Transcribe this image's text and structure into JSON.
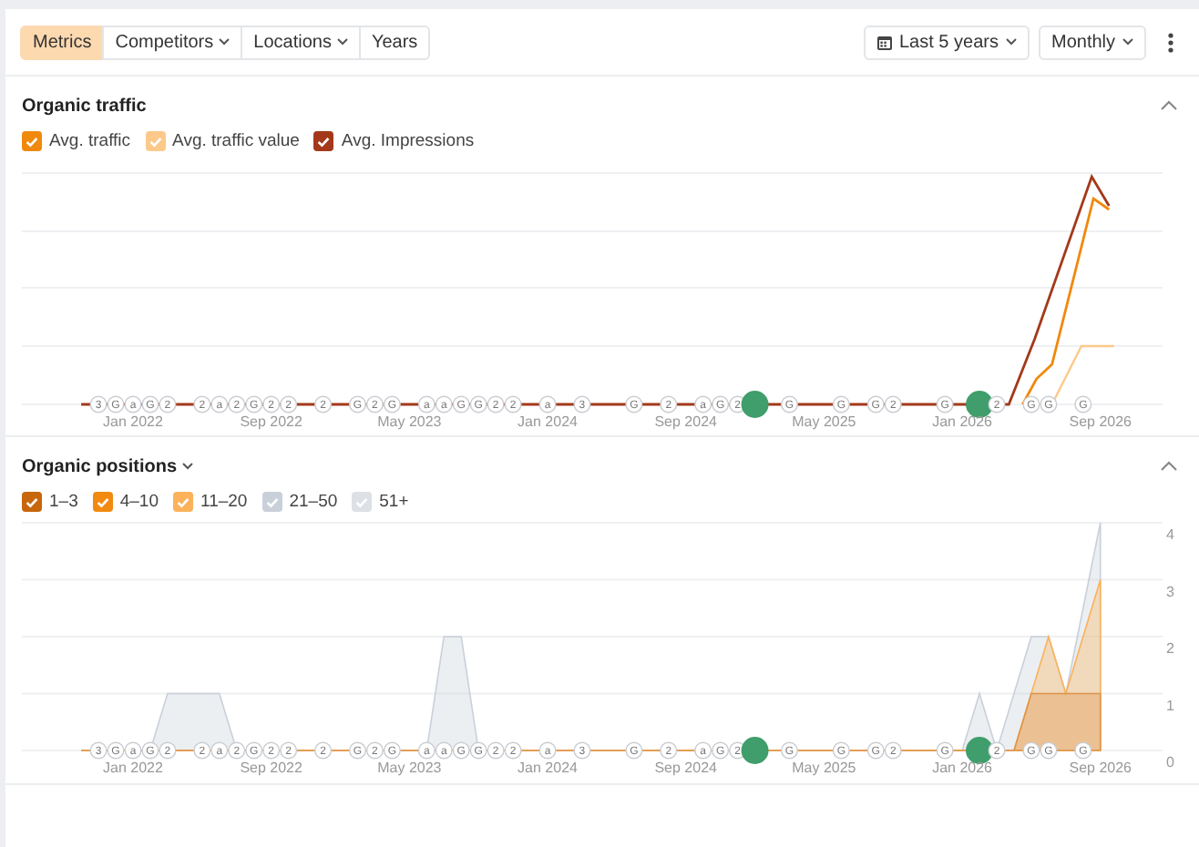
{
  "toolbar": {
    "tabs": [
      {
        "label": "Metrics",
        "selected": true,
        "dropdown": false
      },
      {
        "label": "Competitors",
        "selected": false,
        "dropdown": true
      },
      {
        "label": "Locations",
        "selected": false,
        "dropdown": true
      },
      {
        "label": "Years",
        "selected": false,
        "dropdown": false
      }
    ],
    "date_range": {
      "label": "Last 5 years"
    },
    "interval": {
      "label": "Monthly"
    }
  },
  "sections": [
    {
      "kind": "traffic",
      "title": "Organic traffic",
      "title_dropdown": false,
      "expanded": true,
      "legend": [
        {
          "label": "Avg. traffic",
          "checked": true,
          "color": "#f0890c"
        },
        {
          "label": "Avg. traffic value",
          "checked": true,
          "color": "#fcc98a"
        },
        {
          "label": "Avg. Impressions",
          "checked": true,
          "color": "#a3391a"
        }
      ],
      "timeline": [
        {
          "kind": "none"
        },
        {
          "kind": "tag",
          "label": "3"
        },
        {
          "kind": "tag",
          "label": "G"
        },
        {
          "kind": "tag",
          "label": "a",
          "axis_label": "Jan 2022"
        },
        {
          "kind": "tag",
          "label": "G"
        },
        {
          "kind": "tag",
          "label": "2"
        },
        {
          "kind": "none"
        },
        {
          "kind": "tag",
          "label": "2"
        },
        {
          "kind": "tag",
          "label": "a"
        },
        {
          "kind": "tag",
          "label": "2"
        },
        {
          "kind": "tag",
          "label": "G"
        },
        {
          "kind": "tag",
          "label": "2",
          "axis_label": "Sep 2022"
        },
        {
          "kind": "tag",
          "label": "2"
        },
        {
          "kind": "none"
        },
        {
          "kind": "tag",
          "label": "2"
        },
        {
          "kind": "none"
        },
        {
          "kind": "tag",
          "label": "G"
        },
        {
          "kind": "tag",
          "label": "2"
        },
        {
          "kind": "tag",
          "label": "G"
        },
        {
          "kind": "none",
          "axis_label": "May 2023"
        },
        {
          "kind": "tag",
          "label": "a"
        },
        {
          "kind": "tag",
          "label": "a"
        },
        {
          "kind": "tag",
          "label": "G"
        },
        {
          "kind": "tag",
          "label": "G"
        },
        {
          "kind": "tag",
          "label": "2"
        },
        {
          "kind": "tag",
          "label": "2"
        },
        {
          "kind": "none"
        },
        {
          "kind": "tag",
          "label": "a",
          "axis_label": "Jan 2024"
        },
        {
          "kind": "none"
        },
        {
          "kind": "tag",
          "label": "3"
        },
        {
          "kind": "none"
        },
        {
          "kind": "none"
        },
        {
          "kind": "tag",
          "label": "G"
        },
        {
          "kind": "none"
        },
        {
          "kind": "tag",
          "label": "2"
        },
        {
          "kind": "none",
          "axis_label": "Sep 2024"
        },
        {
          "kind": "tag",
          "label": "a"
        },
        {
          "kind": "tag",
          "label": "G"
        },
        {
          "kind": "tag",
          "label": "2"
        },
        {
          "kind": "event"
        },
        {
          "kind": "none"
        },
        {
          "kind": "tag",
          "label": "G"
        },
        {
          "kind": "none"
        },
        {
          "kind": "none",
          "axis_label": "May 2025"
        },
        {
          "kind": "tag",
          "label": "G"
        },
        {
          "kind": "none"
        },
        {
          "kind": "tag",
          "label": "G"
        },
        {
          "kind": "tag",
          "label": "2"
        },
        {
          "kind": "none"
        },
        {
          "kind": "none"
        },
        {
          "kind": "tag",
          "label": "G"
        },
        {
          "kind": "none",
          "axis_label": "Jan 2026"
        },
        {
          "kind": "event"
        },
        {
          "kind": "tag",
          "label": "2"
        },
        {
          "kind": "none"
        },
        {
          "kind": "tag",
          "label": "G"
        },
        {
          "kind": "tag",
          "label": "G"
        },
        {
          "kind": "none"
        },
        {
          "kind": "tag",
          "label": "G"
        },
        {
          "kind": "none",
          "axis_label": "Sep 2026"
        }
      ]
    },
    {
      "kind": "positions",
      "title": "Organic positions",
      "title_dropdown": true,
      "expanded": true,
      "legend": [
        {
          "label": "1–3",
          "checked": true,
          "color": "#c8660c"
        },
        {
          "label": "4–10",
          "checked": true,
          "color": "#f28a10"
        },
        {
          "label": "11–20",
          "checked": true,
          "color": "#fbb25a"
        },
        {
          "label": "21–50",
          "checked": true,
          "color": "#c9d0da"
        },
        {
          "label": "51+",
          "checked": true,
          "color": "#dde1e6"
        }
      ],
      "timeline": [
        {
          "kind": "none"
        },
        {
          "kind": "tag",
          "label": "3"
        },
        {
          "kind": "tag",
          "label": "G"
        },
        {
          "kind": "tag",
          "label": "a"
        },
        {
          "kind": "tag",
          "label": "G"
        },
        {
          "kind": "tag",
          "label": "2"
        },
        {
          "kind": "none"
        },
        {
          "kind": "tag",
          "label": "2"
        },
        {
          "kind": "tag",
          "label": "a"
        },
        {
          "kind": "tag",
          "label": "2"
        },
        {
          "kind": "tag",
          "label": "G"
        },
        {
          "kind": "tag",
          "label": "2"
        },
        {
          "kind": "tag",
          "label": "2"
        },
        {
          "kind": "none"
        },
        {
          "kind": "tag",
          "label": "2"
        },
        {
          "kind": "none"
        },
        {
          "kind": "tag",
          "label": "G"
        },
        {
          "kind": "tag",
          "label": "2"
        },
        {
          "kind": "tag",
          "label": "G"
        },
        {
          "kind": "none"
        },
        {
          "kind": "tag",
          "label": "a"
        },
        {
          "kind": "tag",
          "label": "a"
        },
        {
          "kind": "tag",
          "label": "G"
        },
        {
          "kind": "tag",
          "label": "G"
        },
        {
          "kind": "tag",
          "label": "2"
        },
        {
          "kind": "tag",
          "label": "2"
        },
        {
          "kind": "none"
        },
        {
          "kind": "tag",
          "label": "a"
        },
        {
          "kind": "none"
        },
        {
          "kind": "tag",
          "label": "3"
        },
        {
          "kind": "none"
        },
        {
          "kind": "none"
        },
        {
          "kind": "tag",
          "label": "G"
        },
        {
          "kind": "none"
        },
        {
          "kind": "tag",
          "label": "2"
        },
        {
          "kind": "none"
        },
        {
          "kind": "tag",
          "label": "a"
        },
        {
          "kind": "tag",
          "label": "G"
        },
        {
          "kind": "tag",
          "label": "2"
        },
        {
          "kind": "event"
        },
        {
          "kind": "none"
        },
        {
          "kind": "tag",
          "label": "G"
        },
        {
          "kind": "none"
        },
        {
          "kind": "none"
        },
        {
          "kind": "tag",
          "label": "G"
        },
        {
          "kind": "none"
        },
        {
          "kind": "tag",
          "label": "G"
        },
        {
          "kind": "tag",
          "label": "2"
        },
        {
          "kind": "none"
        },
        {
          "kind": "none"
        },
        {
          "kind": "tag",
          "label": "G"
        },
        {
          "kind": "none"
        },
        {
          "kind": "event"
        },
        {
          "kind": "tag",
          "label": "2"
        },
        {
          "kind": "none"
        },
        {
          "kind": "tag",
          "label": "G"
        },
        {
          "kind": "tag",
          "label": "G"
        },
        {
          "kind": "none"
        },
        {
          "kind": "tag",
          "label": "G"
        },
        {
          "kind": "none"
        }
      ],
      "chart_data": {
        "type": "area",
        "grid": true,
        "categories": [
          null,
          null,
          null,
          "Jan 2022",
          null,
          null,
          null,
          null,
          null,
          null,
          null,
          "Sep 2022",
          null,
          null,
          null,
          null,
          null,
          null,
          null,
          "May 2023",
          null,
          null,
          null,
          null,
          null,
          null,
          null,
          "Jan 2024",
          null,
          null,
          null,
          null,
          null,
          null,
          null,
          "Sep 2024",
          null,
          null,
          null,
          null,
          null,
          null,
          null,
          "May 2025",
          null,
          null,
          null,
          null,
          null,
          null,
          null,
          "Jan 2026",
          null,
          null,
          null,
          null,
          null,
          null,
          null,
          "Sep 2026"
        ],
        "series": [
          {
            "color": "#c9d0da",
            "values": [
              0,
              0,
              0,
              0,
              0,
              1,
              1,
              1,
              1,
              0,
              0,
              0,
              0,
              0,
              0,
              0,
              0,
              0,
              0,
              0,
              0,
              2,
              2,
              0,
              0,
              0,
              0,
              0,
              0,
              0,
              0,
              0,
              0,
              0,
              0,
              0,
              0,
              0,
              0,
              0,
              0,
              0,
              0,
              0,
              0,
              0,
              0,
              0,
              0,
              0,
              0,
              0,
              1,
              0,
              1,
              2,
              2,
              1,
              2.5,
              4
            ]
          },
          {
            "color": "#fbb25a",
            "values": [
              0,
              0,
              0,
              0,
              0,
              0,
              0,
              0,
              0,
              0,
              0,
              0,
              0,
              0,
              0,
              0,
              0,
              0,
              0,
              0,
              0,
              0,
              0,
              0,
              0,
              0,
              0,
              0,
              0,
              0,
              0,
              0,
              0,
              0,
              0,
              0,
              0,
              0,
              0,
              0,
              0,
              0,
              0,
              0,
              0,
              0,
              0,
              0,
              0,
              0,
              0,
              0,
              0,
              0,
              0,
              1,
              2,
              1,
              2,
              3
            ]
          },
          {
            "color": "#e0954a",
            "values": [
              0,
              0,
              0,
              0,
              0,
              0,
              0,
              0,
              0,
              0,
              0,
              0,
              0,
              0,
              0,
              0,
              0,
              0,
              0,
              0,
              0,
              0,
              0,
              0,
              0,
              0,
              0,
              0,
              0,
              0,
              0,
              0,
              0,
              0,
              0,
              0,
              0,
              0,
              0,
              0,
              0,
              0,
              0,
              0,
              0,
              0,
              0,
              0,
              0,
              0,
              0,
              0,
              0,
              0,
              0,
              1,
              1,
              1,
              1,
              1
            ]
          }
        ],
        "ylim": [
          0,
          4
        ],
        "yticks": [
          0,
          1,
          2,
          3,
          4
        ]
      }
    }
  ]
}
